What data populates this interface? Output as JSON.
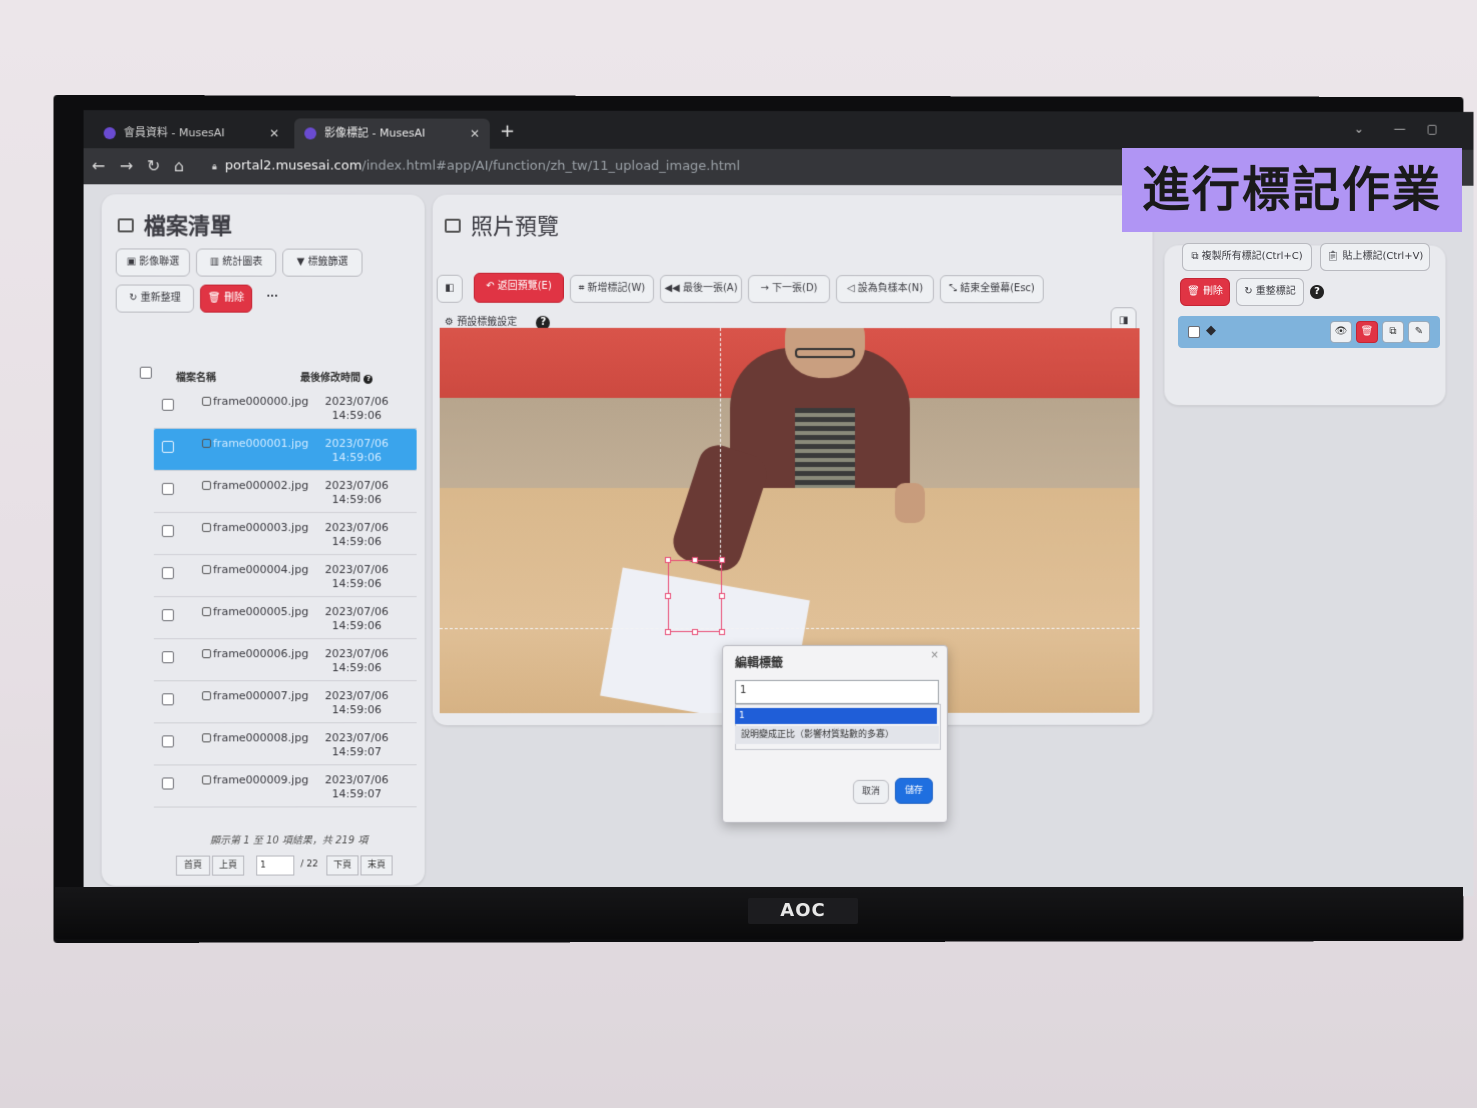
{
  "browser": {
    "tabs": [
      {
        "label": "會員資料 - MusesAI",
        "active": false
      },
      {
        "label": "影像標記 - MusesAI",
        "active": true
      }
    ],
    "new_tab": "+",
    "url_host": "portal2.musesai.com",
    "url_path": "/index.html#app/AI/function/zh_tw/11_upload_image.html"
  },
  "file_panel": {
    "title": "檔案清單",
    "toolbar": [
      "影像聯選",
      "統計圖表",
      "標籤篩選"
    ],
    "reorganize": "重新整理",
    "delete": "刪除",
    "more": "···",
    "col_name": "檔案名稱",
    "col_time": "最後修改時間",
    "rows": [
      {
        "name": "frame000000.jpg",
        "date": "2023/07/06",
        "time": "14:59:06",
        "selected": false
      },
      {
        "name": "frame000001.jpg",
        "date": "2023/07/06",
        "time": "14:59:06",
        "selected": true
      },
      {
        "name": "frame000002.jpg",
        "date": "2023/07/06",
        "time": "14:59:06",
        "selected": false
      },
      {
        "name": "frame000003.jpg",
        "date": "2023/07/06",
        "time": "14:59:06",
        "selected": false
      },
      {
        "name": "frame000004.jpg",
        "date": "2023/07/06",
        "time": "14:59:06",
        "selected": false
      },
      {
        "name": "frame000005.jpg",
        "date": "2023/07/06",
        "time": "14:59:06",
        "selected": false
      },
      {
        "name": "frame000006.jpg",
        "date": "2023/07/06",
        "time": "14:59:06",
        "selected": false
      },
      {
        "name": "frame000007.jpg",
        "date": "2023/07/06",
        "time": "14:59:06",
        "selected": false
      },
      {
        "name": "frame000008.jpg",
        "date": "2023/07/06",
        "time": "14:59:07",
        "selected": false
      },
      {
        "name": "frame000009.jpg",
        "date": "2023/07/06",
        "time": "14:59:07",
        "selected": false
      }
    ],
    "pager_info": "顯示第 1 至 10 項結果，共 219 項",
    "first": "首頁",
    "prev": "上頁",
    "page_value": "1",
    "page_total": "/ 22",
    "next": "下頁",
    "last": "末頁"
  },
  "preview": {
    "title": "照片預覽",
    "back_btn": "返回預覽(E)",
    "new_label": "新增標記(W)",
    "prev_img": "最後一張(A)",
    "next_img": "下一張(D)",
    "set_negative": "設為負樣本(N)",
    "finish": "結束全螢幕(Esc)",
    "settings": "預設標籤設定"
  },
  "dialog": {
    "title": "編輯標籤",
    "close": "×",
    "input_value": "1",
    "option_selected": "1",
    "option_2": "說明變成正比（影響材質點數的多寡）",
    "cancel": "取消",
    "save": "儲存"
  },
  "right_panel": {
    "copy_all": "複製所有標記(Ctrl+C)",
    "paste": "貼上標記(Ctrl+V)",
    "delete": "刪除",
    "reorganize": "重整標記"
  },
  "overlay_caption": "進行標記作業",
  "monitor_brand": "AOC",
  "colors": {
    "accent_red": "#e03444",
    "accent_blue": "#1f6fe0",
    "selected_row": "#3aa4ec",
    "overlay": "#b095f4"
  }
}
